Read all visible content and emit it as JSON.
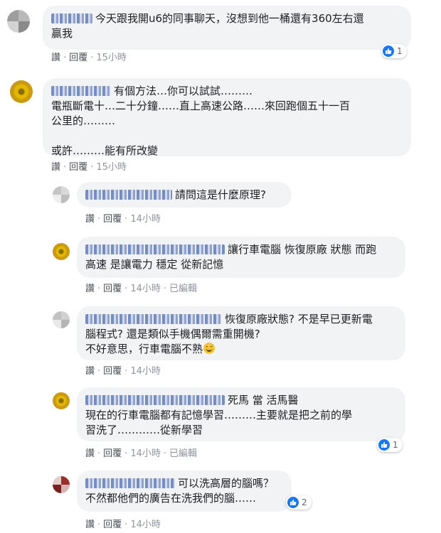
{
  "comments": [
    {
      "text_lines": [
        "今天跟我開u6的同事聊天，沒想到他一桶還有360左右還",
        "贏我"
      ],
      "actions": {
        "like": "讚",
        "reply": "回覆",
        "time": "15小時",
        "edited": ""
      },
      "reactions": "1"
    },
    {
      "text_lines": [
        "有個方法…你可以試試………",
        "電瓶斷電十…二十分鐘……直上高速公路……來回跑個五十一百",
        "公里的………",
        "",
        "或許………能有所改變"
      ],
      "actions": {
        "like": "讚",
        "reply": "回覆",
        "time": "15小時",
        "edited": ""
      },
      "reactions": ""
    }
  ],
  "replies": [
    {
      "text_lines": [
        "請問這是什麼原理?"
      ],
      "actions": {
        "like": "讚",
        "reply": "回覆",
        "time": "14小時",
        "edited": ""
      },
      "reactions": ""
    },
    {
      "text_lines": [
        "讓行車電腦 恢復原廠 狀態 而跑",
        "高速 是讓電力 穩定 從新記憶"
      ],
      "actions": {
        "like": "讚",
        "reply": "回覆",
        "time": "14小時",
        "edited": "已編輯"
      },
      "reactions": ""
    },
    {
      "text_lines": [
        "恢復原廠狀態? 不是早已更新電",
        "腦程式? 還是類似手機偶爾需重開機?",
        "不好意思，行車電腦不熟"
      ],
      "actions": {
        "like": "讚",
        "reply": "回覆",
        "time": "14小時",
        "edited": ""
      },
      "reactions": ""
    },
    {
      "text_lines": [
        "死馬 當 活馬醫",
        "現在的行車電腦都有記憶學習………主要就是把之前的學",
        "習洗了…………從新學習"
      ],
      "actions": {
        "like": "讚",
        "reply": "回覆",
        "time": "14小時",
        "edited": "已編輯"
      },
      "reactions": "1"
    },
    {
      "text_lines": [
        "可以洗高層的腦嗎？",
        "不然都他們的廣告在洗我們的腦……"
      ],
      "actions": {
        "like": "讚",
        "reply": "回覆",
        "time": "14小時",
        "edited": ""
      },
      "reactions": "2"
    }
  ],
  "colors": {
    "like_blue": "#1877f2",
    "bubble": "#f2f3f5",
    "meta": "#90949c"
  }
}
